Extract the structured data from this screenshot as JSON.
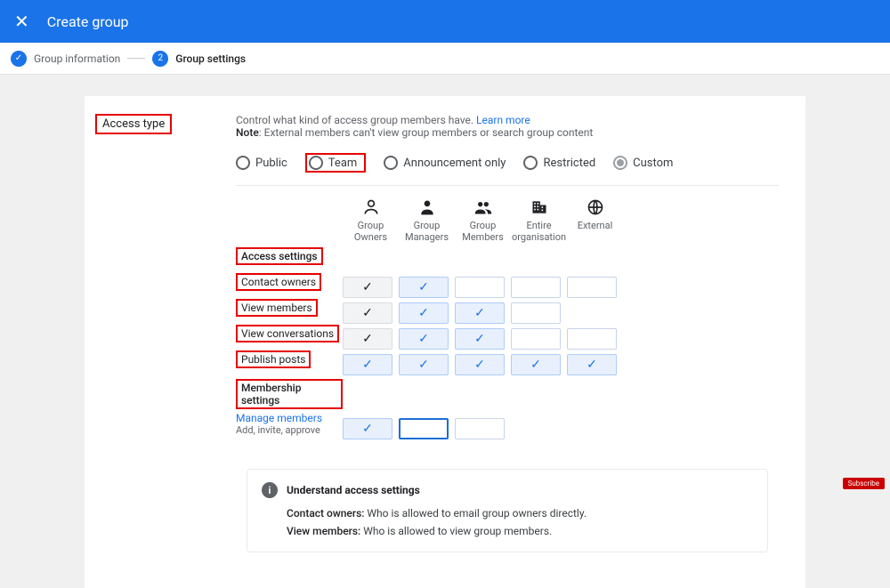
{
  "header": {
    "title": "Create group"
  },
  "stepper": {
    "step1_label": "Group information",
    "step2_num": "2",
    "step2_label": "Group settings"
  },
  "access": {
    "section_title": "Access type",
    "intro_line1_a": "Control what kind of access group members have. ",
    "intro_learn_more": "Learn more",
    "intro_line2_a": "Note",
    "intro_line2_b": ": External members can't view group members or search group content",
    "radios": {
      "public": "Public",
      "team": "Team",
      "announcement": "Announcement only",
      "restricted": "Restricted",
      "custom": "Custom"
    },
    "columns": {
      "owners": "Group Owners",
      "managers": "Group Managers",
      "members": "Group Members",
      "org": "Entire organisation",
      "external": "External"
    },
    "access_settings_label": "Access settings",
    "rows": {
      "contact_owners": "Contact owners",
      "view_members": "View members",
      "view_conversations": "View conversations",
      "publish_posts": "Publish posts"
    },
    "membership_settings_label": "Membership settings",
    "manage_members": "Manage members",
    "manage_members_sub": "Add, invite, approve"
  },
  "info": {
    "title": "Understand access settings",
    "contact_label": "Contact owners:",
    "contact_text": " Who is allowed to email group owners directly.",
    "view_label": "View members:",
    "view_text": " Who is allowed to view group members."
  },
  "subscribe": "Subscribe"
}
